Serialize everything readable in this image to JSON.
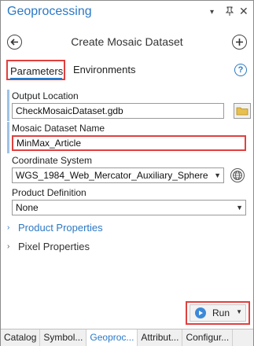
{
  "window": {
    "title": "Geoprocessing",
    "controls": {
      "menu": "▾",
      "pin": "⊓",
      "close": "✕"
    }
  },
  "header": {
    "tool_title": "Create Mosaic Dataset",
    "back_icon": "back-arrow-icon",
    "add_icon": "add-icon"
  },
  "tabs": {
    "parameters": "Parameters",
    "environments": "Environments",
    "help": "?"
  },
  "params": {
    "output_location": {
      "label": "Output Location",
      "value": "CheckMosaicDataset.gdb"
    },
    "mosaic_name": {
      "label": "Mosaic Dataset Name",
      "value": "MinMax_Article"
    },
    "coord_system": {
      "label": "Coordinate System",
      "value": "WGS_1984_Web_Mercator_Auxiliary_Sphere"
    },
    "product_def": {
      "label": "Product Definition",
      "value": "None"
    }
  },
  "sections": {
    "product_properties": "Product Properties",
    "pixel_properties": "Pixel Properties"
  },
  "run": {
    "label": "Run"
  },
  "bottom_tabs": [
    "Catalog",
    "Symbol...",
    "Geoproc...",
    "Attribut...",
    "Configur..."
  ],
  "colors": {
    "accent": "#2b78c5",
    "highlight": "#e0403f"
  }
}
